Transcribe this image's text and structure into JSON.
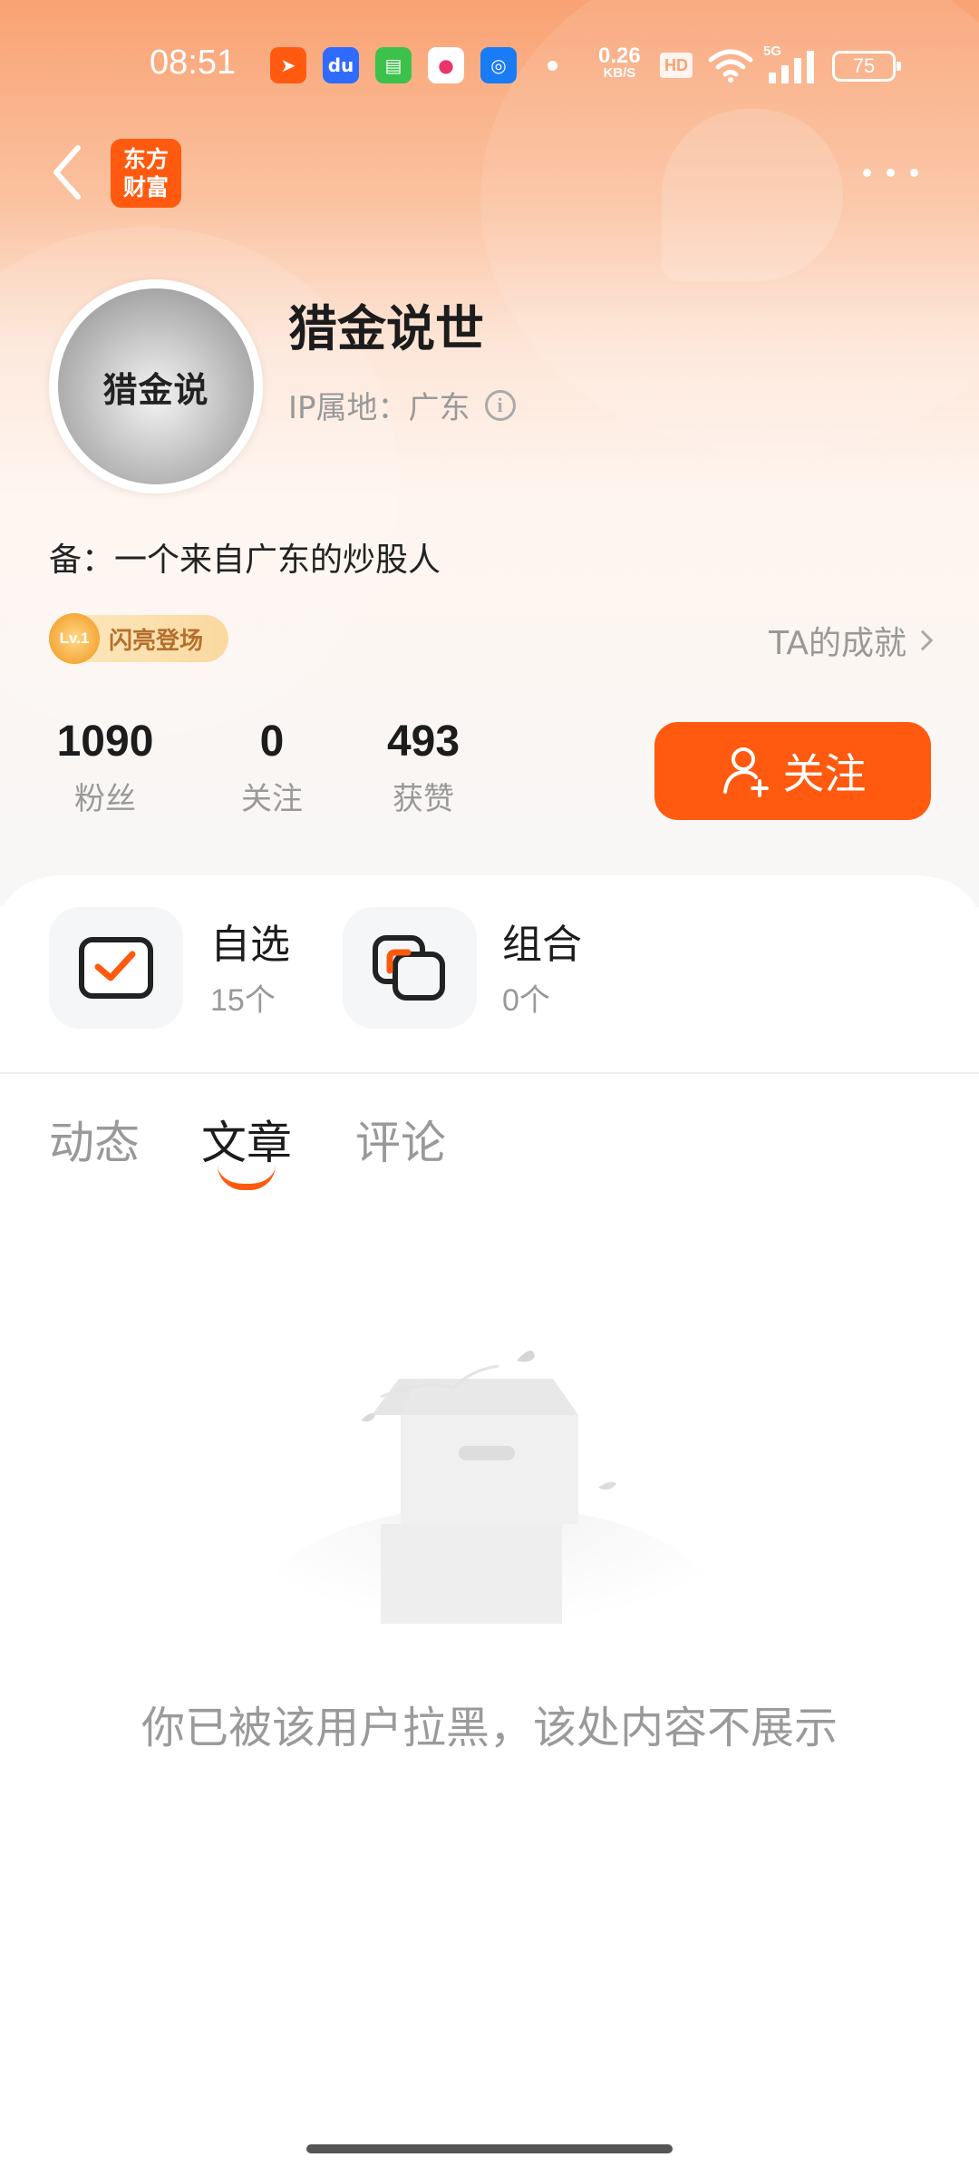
{
  "status_bar": {
    "time": "08:51",
    "net_speed_value": "0.26",
    "net_speed_unit": "KB/S",
    "hd": "HD",
    "signal": "5G",
    "battery": "75"
  },
  "header": {
    "brand_logo_line1": "东方",
    "brand_logo_line2": "财富",
    "brand_color": "#ff5a0f"
  },
  "profile": {
    "avatar_text": "猎金说",
    "name": "猎金说世",
    "ip_location": "IP属地：广东",
    "bio": "备：一个来自广东的炒股人",
    "level_badge": "Lv.1",
    "level_title": "闪亮登场",
    "achievements_link": "TA的成就"
  },
  "stats": [
    {
      "value": "1090",
      "label": "粉丝"
    },
    {
      "value": "0",
      "label": "关注"
    },
    {
      "value": "493",
      "label": "获赞"
    }
  ],
  "follow_button": "关注",
  "shortcuts": [
    {
      "title": "自选",
      "count": "15个",
      "icon": "checkbox-icon"
    },
    {
      "title": "组合",
      "count": "0个",
      "icon": "portfolio-icon"
    }
  ],
  "tabs": [
    {
      "label": "动态",
      "active": false
    },
    {
      "label": "文章",
      "active": true
    },
    {
      "label": "评论",
      "active": false
    }
  ],
  "empty_state": {
    "message": "你已被该用户拉黑，该处内容不展示",
    "icon": "empty-box-icon"
  }
}
